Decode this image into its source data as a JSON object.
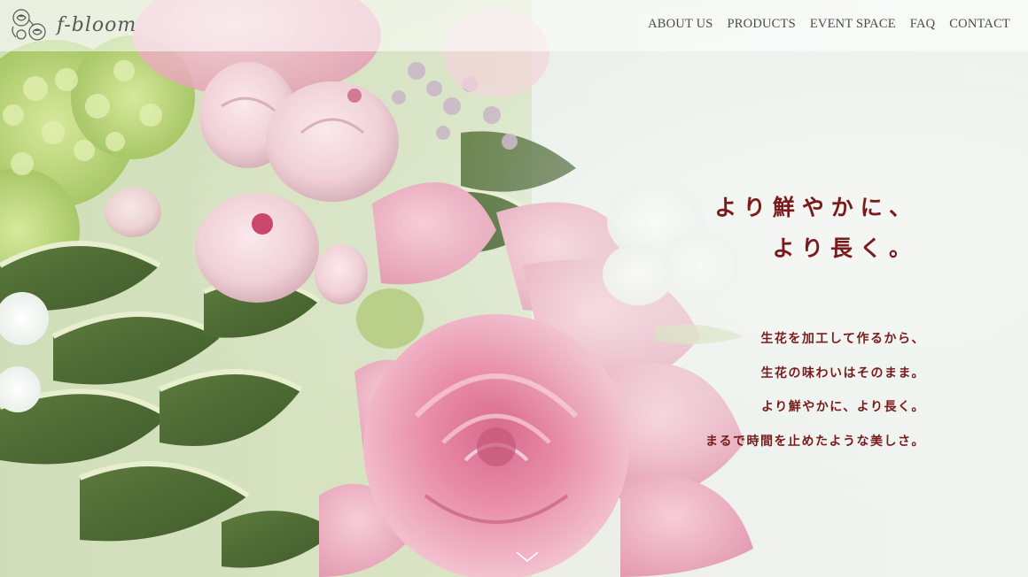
{
  "brand": {
    "name": "f-bloom",
    "logo_icon": "rose-logo-icon"
  },
  "nav": {
    "items": [
      {
        "label": "ABOUT US"
      },
      {
        "label": "PRODUCTS"
      },
      {
        "label": "EVENT SPACE"
      },
      {
        "label": "FAQ"
      },
      {
        "label": "CONTACT"
      }
    ]
  },
  "hero": {
    "headline_line1": "より鮮やかに、",
    "headline_line2": "より長く。",
    "copy": [
      "生花を加工して作るから、",
      "生花の味わいはそのまま。",
      "より鮮やかに、より長く。",
      "まるで時間を止めたような美しさ。"
    ],
    "scroll_icon": "chevron-down-icon"
  },
  "colors": {
    "accent_text": "#7a1a1a",
    "nav_text": "#4a4a4a",
    "rose_pink": "#e8a0b4",
    "leaf_green": "#6f8f4a"
  }
}
